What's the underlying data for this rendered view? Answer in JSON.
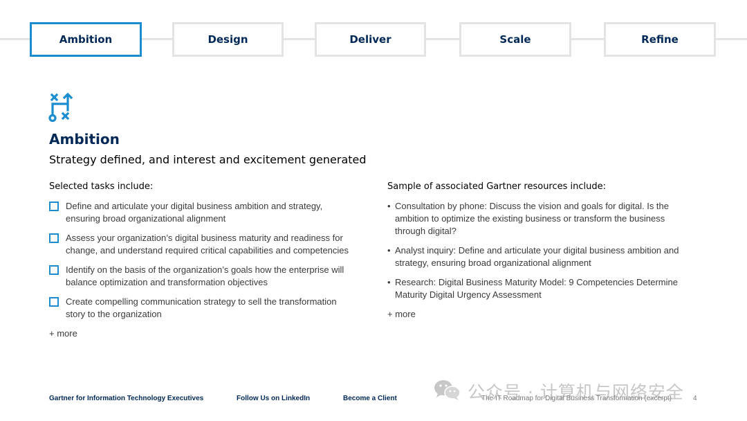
{
  "steps": [
    {
      "label": "Ambition",
      "active": true
    },
    {
      "label": "Design",
      "active": false
    },
    {
      "label": "Deliver",
      "active": false
    },
    {
      "label": "Scale",
      "active": false
    },
    {
      "label": "Refine",
      "active": false
    }
  ],
  "section": {
    "icon": "strategy-path-icon",
    "title": "Ambition",
    "subtitle": "Strategy defined, and interest and excitement generated"
  },
  "tasks": {
    "heading": "Selected tasks include:",
    "items": [
      "Define and articulate your digital business ambition and strategy, ensuring broad organizational alignment",
      "Assess your organization’s digital business maturity and readiness for change, and understand required critical capabilities and competencies",
      "Identify on the basis of the organization’s goals how the enterprise will balance optimization and transformation objectives",
      "Create compelling communication strategy to sell the transformation story to the organization"
    ],
    "more": "+ more"
  },
  "resources": {
    "heading": "Sample of associated Gartner resources include:",
    "bullet": "•",
    "items": [
      "Consultation by phone: Discuss the vision and goals for digital. Is the ambition to optimize the existing business or transform the business through digital?",
      "Analyst inquiry: Define and articulate your digital business ambition and strategy, ensuring broad organizational alignment",
      "Research: Digital Business Maturity Model: 9 Competencies Determine Maturity Digital Urgency Assessment"
    ],
    "more": "+ more"
  },
  "footer": {
    "links": [
      "Gartner for Information Technology Executives",
      "Follow Us on LinkedIn",
      "Become a Client"
    ],
    "caption": "The IT Roadmap for Digital Business Transformation (excerpt)",
    "page_number": "4"
  },
  "watermark": {
    "icon": "wechat-icon",
    "text": "公众号 · 计算机与网络安全"
  },
  "colors": {
    "accent": "#1a8ccf",
    "navy": "#002856",
    "inactive_border": "#e3e3e3"
  }
}
